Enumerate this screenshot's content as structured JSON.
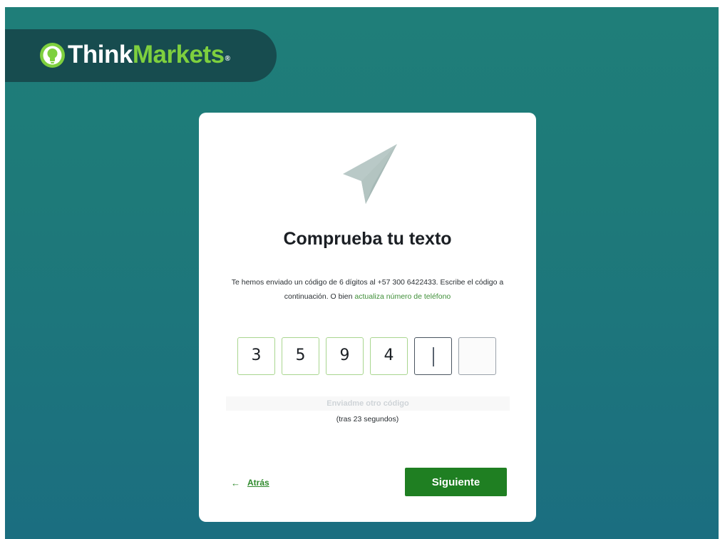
{
  "brand": {
    "name_part1": "Think",
    "name_part2": "Markets",
    "registered_mark": "®",
    "colors": {
      "dark_teal": "#174c4f",
      "green": "#7ed03e"
    }
  },
  "card": {
    "icon": "paper-plane-icon",
    "title": "Comprueba tu texto",
    "description": "Te hemos enviado un código de 6 dígitos al +57 300 6422433. Escribe el código a continuación. O bien ",
    "update_phone_link": "actualiza número de teléfono",
    "code_digits": [
      "3",
      "5",
      "9",
      "4",
      "",
      ""
    ],
    "resend_label": "Enviadme otro código",
    "timer_text": "(tras 23 segundos)",
    "back_label": "Atrás",
    "back_icon": "arrow-left-icon",
    "next_label": "Siguiente",
    "colors": {
      "primary_button": "#1f7f22",
      "link": "#3f8f38"
    }
  }
}
